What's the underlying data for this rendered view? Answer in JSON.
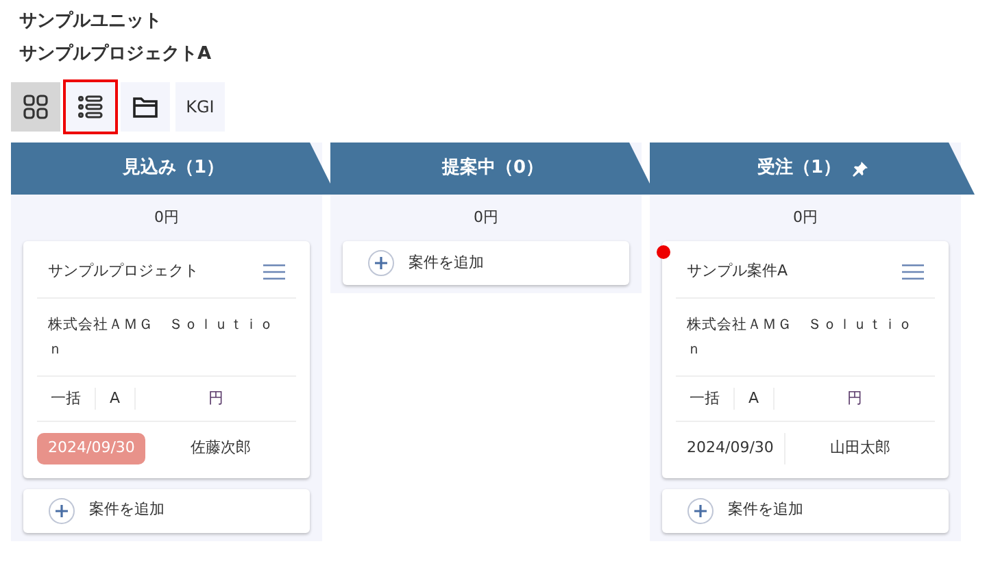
{
  "breadcrumb": [
    "サンプルユニット",
    "サンプルプロジェクトA"
  ],
  "view_buttons": [
    {
      "kind": "grid",
      "selected": true,
      "focused": false
    },
    {
      "kind": "list",
      "selected": false,
      "focused": true
    },
    {
      "kind": "folder",
      "selected": false,
      "focused": false
    },
    {
      "kind": "text",
      "label": "KGI",
      "selected": false,
      "focused": false
    }
  ],
  "columns": [
    {
      "title": "見込み（1）",
      "pinned": false,
      "total": "0円",
      "cards": [
        {
          "title": "サンプルプロジェクト",
          "alert": false,
          "company": "株式会社ＡＭＧ　Ｓｏｌｕｔｉｏｎ",
          "payment": "一括",
          "rank": "A",
          "amount": "円",
          "date": "2024/09/30",
          "overdue": true,
          "person": "佐藤次郎"
        }
      ],
      "add_label": "案件を追加"
    },
    {
      "title": "提案中（0）",
      "pinned": false,
      "total": "0円",
      "add_label": "案件を追加"
    },
    {
      "title": "受注（1）",
      "pinned": true,
      "total": "0円",
      "cards": [
        {
          "title": "サンプル案件A",
          "alert": true,
          "company": "株式会社ＡＭＧ　Ｓｏｌｕｔｉｏｎ",
          "payment": "一括",
          "rank": "A",
          "amount": "円",
          "date": "2024/09/30",
          "overdue": false,
          "person": "山田太郎"
        }
      ],
      "add_label": "案件を追加"
    }
  ]
}
